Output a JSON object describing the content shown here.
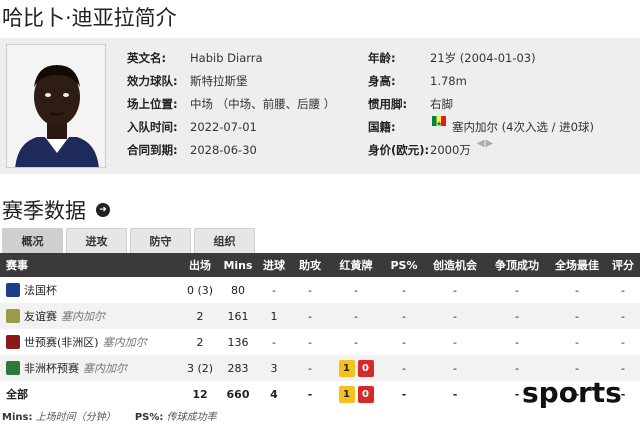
{
  "page_title": "哈比卜·迪亚拉简介",
  "profile": {
    "left": [
      {
        "label": "英文名:",
        "value": "Habib Diarra"
      },
      {
        "label": "效力球队:",
        "value": "斯特拉斯堡"
      },
      {
        "label": "场上位置:",
        "value": "中场 （中场、前腰、后腰 ）"
      },
      {
        "label": "入队时间:",
        "value": "2022-07-01"
      },
      {
        "label": "合同到期:",
        "value": "2028-06-30"
      }
    ],
    "right": [
      {
        "label": "年龄:",
        "value": "21岁  (2004-01-03)"
      },
      {
        "label": "身高:",
        "value": "1.78m"
      },
      {
        "label": "惯用脚:",
        "value": "右脚"
      },
      {
        "label": "国籍:",
        "value": "塞内加尔 (4次入选 / 进0球)"
      },
      {
        "label": "身价(欧元):",
        "value": "2000万"
      }
    ]
  },
  "season_title": "赛季数据",
  "tabs": [
    "概况",
    "进攻",
    "防守",
    "组织"
  ],
  "active_tab": 0,
  "table": {
    "headers": [
      "赛事",
      "出场",
      "Mins",
      "进球",
      "助攻",
      "红黄牌",
      "PS%",
      "创造机会",
      "争顶成功",
      "全场最佳",
      "评分"
    ],
    "rows": [
      {
        "comp": "法国杯",
        "team": "",
        "icon_color": "#1d3f8a",
        "apps": "0 (3)",
        "mins": "80",
        "goals": "-",
        "assists": "-",
        "cards": null,
        "ps": "-",
        "chances": "-",
        "aerial": "-",
        "motm": "-",
        "rating": "-"
      },
      {
        "comp": "友谊赛",
        "team": "塞内加尔",
        "icon_color": "#9a9a4a",
        "apps": "2",
        "mins": "161",
        "goals": "1",
        "assists": "-",
        "cards": null,
        "ps": "-",
        "chances": "-",
        "aerial": "-",
        "motm": "-",
        "rating": "-"
      },
      {
        "comp": "世预赛(非洲区)",
        "team": "塞内加尔",
        "icon_color": "#8a1a1a",
        "apps": "2",
        "mins": "136",
        "goals": "-",
        "assists": "-",
        "cards": null,
        "ps": "-",
        "chances": "-",
        "aerial": "-",
        "motm": "-",
        "rating": "-"
      },
      {
        "comp": "非洲杯预赛",
        "team": "塞内加尔",
        "icon_color": "#2a7a3a",
        "apps": "3 (2)",
        "mins": "283",
        "goals": "3",
        "assists": "-",
        "cards": {
          "yellow": "1",
          "red": "0"
        },
        "ps": "-",
        "chances": "-",
        "aerial": "-",
        "motm": "-",
        "rating": "-"
      }
    ],
    "total": {
      "label": "全部",
      "apps": "12",
      "mins": "660",
      "goals": "4",
      "assists": "-",
      "cards": {
        "yellow": "1",
        "red": "0"
      },
      "ps": "-",
      "chances": "-",
      "aerial": "-",
      "motm": "-",
      "rating": "-"
    }
  },
  "footnote": {
    "mins_key": "Mins:",
    "mins_text": "上场时间（分钟）",
    "ps_key": "PS%:",
    "ps_text": "传球成功率"
  },
  "watermark": "sports"
}
